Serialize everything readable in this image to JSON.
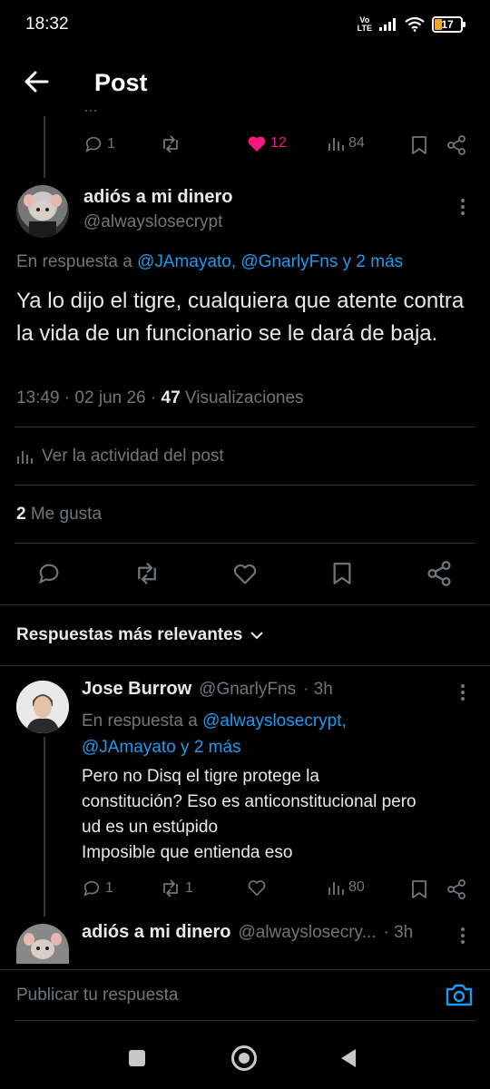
{
  "status_bar": {
    "time": "18:32",
    "network": "Vo LTE",
    "battery": "17"
  },
  "header": {
    "title": "Post"
  },
  "parent_tweet": {
    "truncated_text": "…",
    "replies": "1",
    "likes": "12",
    "views": "84"
  },
  "main_tweet": {
    "display_name": "adiós a mi dinero",
    "handle": "@alwayslosecrypt",
    "reply_prefix": "En respuesta a",
    "reply_to": "@JAmayato, @GnarlyFns y 2 más",
    "text": "Ya lo dijo el tigre, cualquiera que atente contra la vida de un funcionario se le dará de baja.",
    "time": "13:49 · 02 jun 26 ·",
    "views_count": "47",
    "views_label": "Visualizaciones",
    "activity_label": "Ver la actividad del post",
    "likes_count": "2",
    "likes_label": "Me gusta"
  },
  "sort": {
    "label": "Respuestas más relevantes"
  },
  "replies": [
    {
      "display_name": "Jose Burrow",
      "handle": "@GnarlyFns",
      "time": "· 3h",
      "reply_prefix": "En respuesta a",
      "reply_to_line1": "@alwayslosecrypt,",
      "reply_to_line2": "@JAmayato y 2 más",
      "text_lines": [
        "Pero no Disq el tigre protege la",
        "constitución? Eso es anticonstitucional pero",
        "ud es un estúpido",
        "Imposible que entienda eso"
      ],
      "reply_count": "1",
      "retweet_count": "1",
      "views": "80"
    },
    {
      "display_name": "adiós a mi dinero",
      "handle": "@alwayslosecry...",
      "time": "· 3h"
    }
  ],
  "compose": {
    "placeholder": "Publicar tu respuesta"
  },
  "colors": {
    "background": "#000000",
    "text": "#e7e9ea",
    "muted": "#71767b",
    "accent": "#1d9bf0",
    "like": "#f91880",
    "divider": "#2f3336"
  }
}
